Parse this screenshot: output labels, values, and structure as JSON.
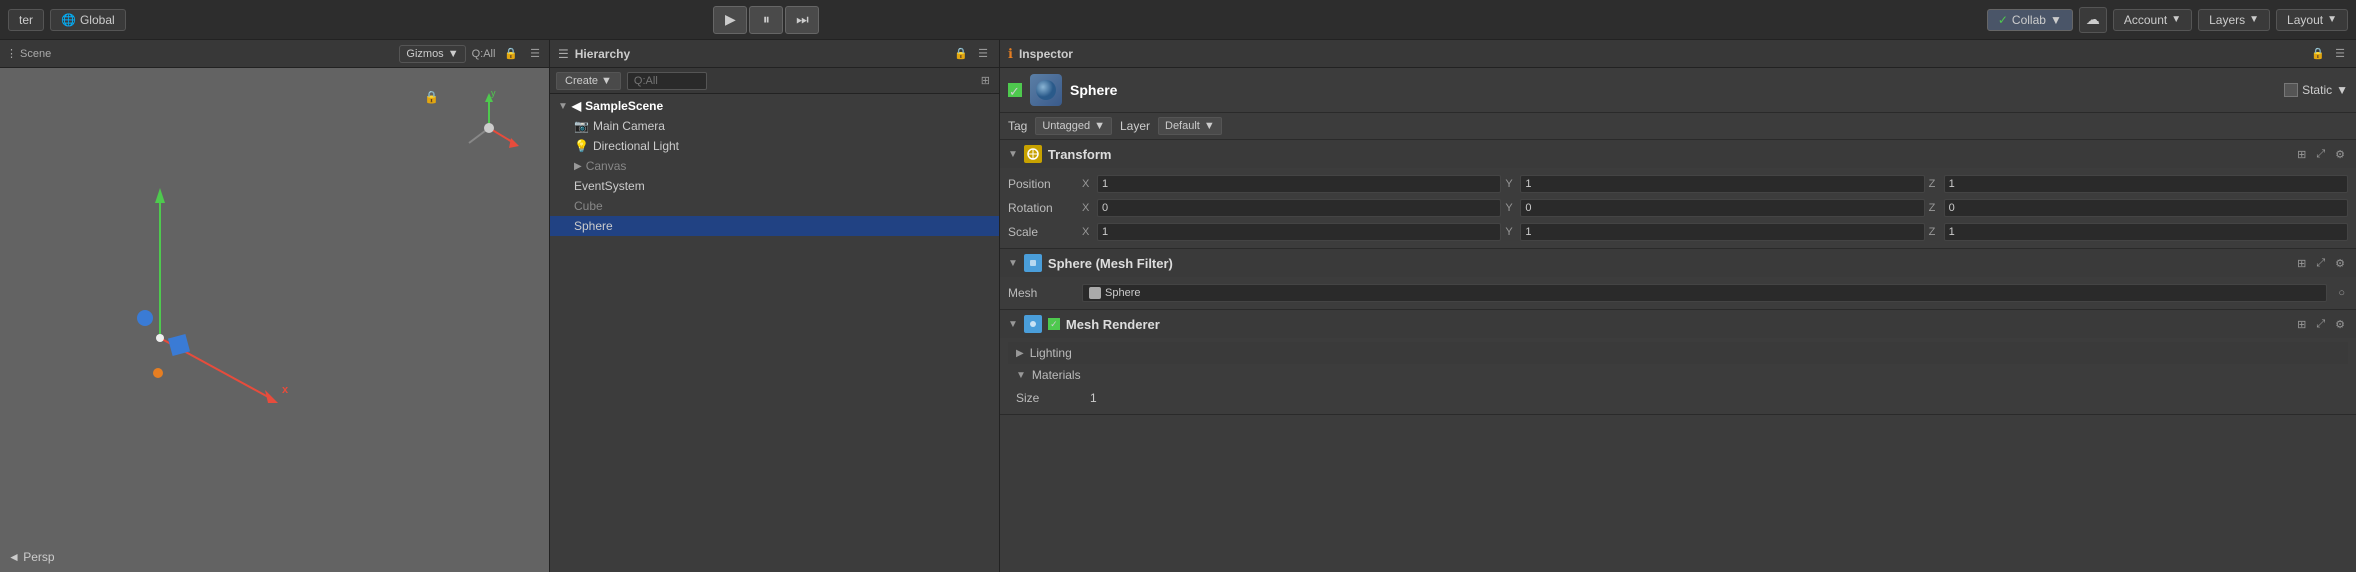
{
  "topbar": {
    "left_btn": "ter",
    "global_btn": "Global",
    "play_icon": "▶",
    "pause_icon": "⏸",
    "step_icon": "⏭",
    "collab_label": "Collab",
    "cloud_icon": "☁",
    "account_label": "Account",
    "layers_label": "Layers",
    "layout_label": "Layout"
  },
  "scene": {
    "gizmos_label": "Gizmos",
    "gizmos_arrow": "▼",
    "search_placeholder": "Q:All",
    "persp_label": "◄ Persp"
  },
  "hierarchy": {
    "title": "Hierarchy",
    "create_label": "Create",
    "search_placeholder": "Q:All",
    "scene_name": "SampleScene",
    "items": [
      {
        "name": "Main Camera",
        "indent": 1,
        "selected": false,
        "grayed": false
      },
      {
        "name": "Directional Light",
        "indent": 1,
        "selected": false,
        "grayed": false
      },
      {
        "name": "Canvas",
        "indent": 1,
        "selected": false,
        "grayed": true,
        "collapsed": true
      },
      {
        "name": "EventSystem",
        "indent": 1,
        "selected": false,
        "grayed": false
      },
      {
        "name": "Cube",
        "indent": 1,
        "selected": false,
        "grayed": true
      },
      {
        "name": "Sphere",
        "indent": 1,
        "selected": true,
        "grayed": false
      }
    ]
  },
  "inspector": {
    "title": "Inspector",
    "object_name": "Sphere",
    "static_label": "Static",
    "tag_label": "Tag",
    "tag_value": "Untagged",
    "layer_label": "Layer",
    "layer_value": "Default",
    "transform": {
      "title": "Transform",
      "position_label": "Position",
      "position_x": "1",
      "position_y": "1",
      "position_z": "1",
      "rotation_label": "Rotation",
      "rotation_x": "0",
      "rotation_y": "0",
      "rotation_z": "0",
      "scale_label": "Scale",
      "scale_x": "1",
      "scale_y": "1",
      "scale_z": "1"
    },
    "mesh_filter": {
      "title": "Sphere (Mesh Filter)",
      "mesh_label": "Mesh",
      "mesh_value": "Sphere"
    },
    "mesh_renderer": {
      "title": "Mesh Renderer",
      "lighting_label": "Lighting",
      "materials_label": "Materials",
      "size_label": "Size",
      "size_value": "1"
    }
  }
}
